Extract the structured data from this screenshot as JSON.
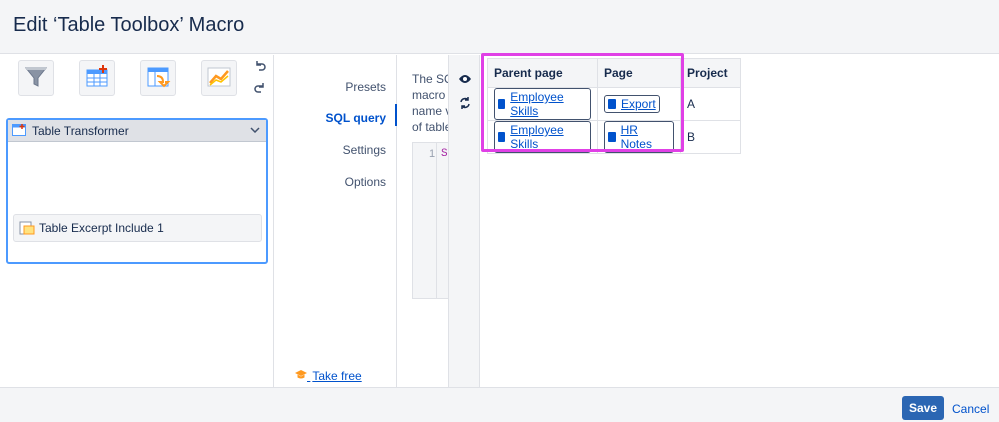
{
  "header": {
    "title": "Edit ‘Table Toolbox’ Macro"
  },
  "toolbar": {
    "tools": [
      {
        "icon": "filter-icon"
      },
      {
        "icon": "table-add-icon"
      },
      {
        "icon": "table-transform-icon"
      },
      {
        "icon": "chart-icon"
      }
    ],
    "undo_icon": "undo-icon",
    "redo_icon": "redo-icon"
  },
  "macro_tree": {
    "outer_label": "Table Transformer",
    "inner_label": "Table Excerpt Include 1"
  },
  "nav": {
    "items": [
      "Presets",
      "SQL query",
      "Settings",
      "Options"
    ],
    "active": "SQL query",
    "course_link": "Take free course"
  },
  "editor": {
    "description_lines": [
      "The SQ",
      "macro V",
      "name v",
      "of table"
    ],
    "line_number": "1",
    "code_text": "SI"
  },
  "preview": {
    "headers": [
      "Parent page",
      "Page",
      "Project"
    ],
    "rows": [
      {
        "parent": "Employee Skills",
        "page": "Export",
        "project": "A"
      },
      {
        "parent": "Employee Skills",
        "page": "HR Notes",
        "project": "B"
      }
    ],
    "highlight_color": "#e040e6"
  },
  "footer": {
    "save_label": "Save",
    "cancel_label": "Cancel"
  },
  "colors": {
    "accent": "#0052cc",
    "save_bg": "#2b66b3"
  }
}
